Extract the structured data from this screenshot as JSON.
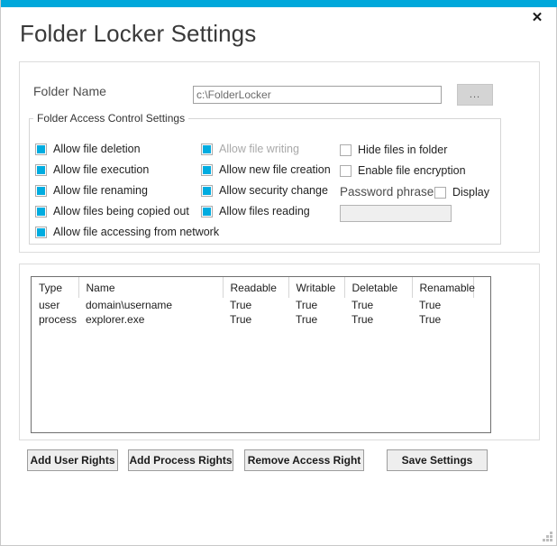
{
  "window": {
    "title": "Folder Locker Settings",
    "close_label": "✕",
    "accent_color": "#00a8db"
  },
  "folder": {
    "label": "Folder Name",
    "value": "c:\\FolderLocker",
    "placeholder": "",
    "browse_label": "..."
  },
  "group": {
    "title": "Folder Access Control Settings",
    "column1": [
      {
        "label": "Allow file deletion",
        "checked": true,
        "disabled": false
      },
      {
        "label": "Allow file execution",
        "checked": true,
        "disabled": false
      },
      {
        "label": "Allow file renaming",
        "checked": true,
        "disabled": false
      },
      {
        "label": "Allow files being copied out",
        "checked": true,
        "disabled": false
      },
      {
        "label": "Allow file accessing from network",
        "checked": true,
        "disabled": false
      }
    ],
    "column2": [
      {
        "label": "Allow file writing",
        "checked": true,
        "disabled": true
      },
      {
        "label": "Allow new file creation",
        "checked": true,
        "disabled": false
      },
      {
        "label": "Allow security change",
        "checked": true,
        "disabled": false
      },
      {
        "label": "Allow files reading",
        "checked": true,
        "disabled": false
      }
    ],
    "column3": [
      {
        "label": "Hide files in folder",
        "checked": false,
        "disabled": false
      },
      {
        "label": "Enable file encryption",
        "checked": false,
        "disabled": false
      }
    ],
    "password": {
      "label": "Password phrase",
      "display_label": "Display",
      "display_checked": false,
      "value": "",
      "placeholder": ""
    }
  },
  "rights_table": {
    "columns": [
      "Type",
      "Name",
      "Readable",
      "Writable",
      "Deletable",
      "Renamable",
      ""
    ],
    "rows": [
      [
        "user",
        "domain\\username",
        "True",
        "True",
        "True",
        "True",
        ""
      ],
      [
        "process",
        "explorer.exe",
        "True",
        "True",
        "True",
        "True",
        ""
      ]
    ]
  },
  "actions": {
    "add_user": "Add User Rights",
    "add_process": "Add Process Rights",
    "remove": "Remove Access Right",
    "save": "Save Settings"
  }
}
